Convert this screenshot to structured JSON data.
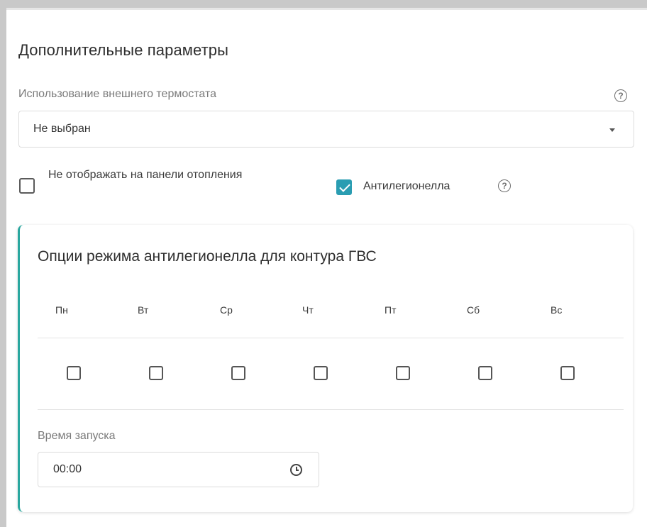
{
  "section": {
    "title": "Дополнительные параметры"
  },
  "thermostat": {
    "label": "Использование внешнего термостата",
    "value": "Не выбран",
    "help_icon": "help-circle-icon"
  },
  "options": {
    "hide_panel_label": "Не отображать на панели отопления",
    "hide_panel_checked": false,
    "antilegionella_label": "Антилегионелла",
    "antilegionella_checked": true
  },
  "antilegionella_card": {
    "title": "Опции режима антилегионелла для контура ГВС",
    "days": [
      {
        "label": "Пн",
        "checked": false
      },
      {
        "label": "Вт",
        "checked": false
      },
      {
        "label": "Ср",
        "checked": false
      },
      {
        "label": "Чт",
        "checked": false
      },
      {
        "label": "Пт",
        "checked": false
      },
      {
        "label": "Сб",
        "checked": false
      },
      {
        "label": "Вс",
        "checked": false
      }
    ],
    "start_time_label": "Время запуска",
    "start_time_value": "00:00"
  },
  "colors": {
    "accent": "#2a9db2",
    "card_border": "#2aa79f"
  }
}
